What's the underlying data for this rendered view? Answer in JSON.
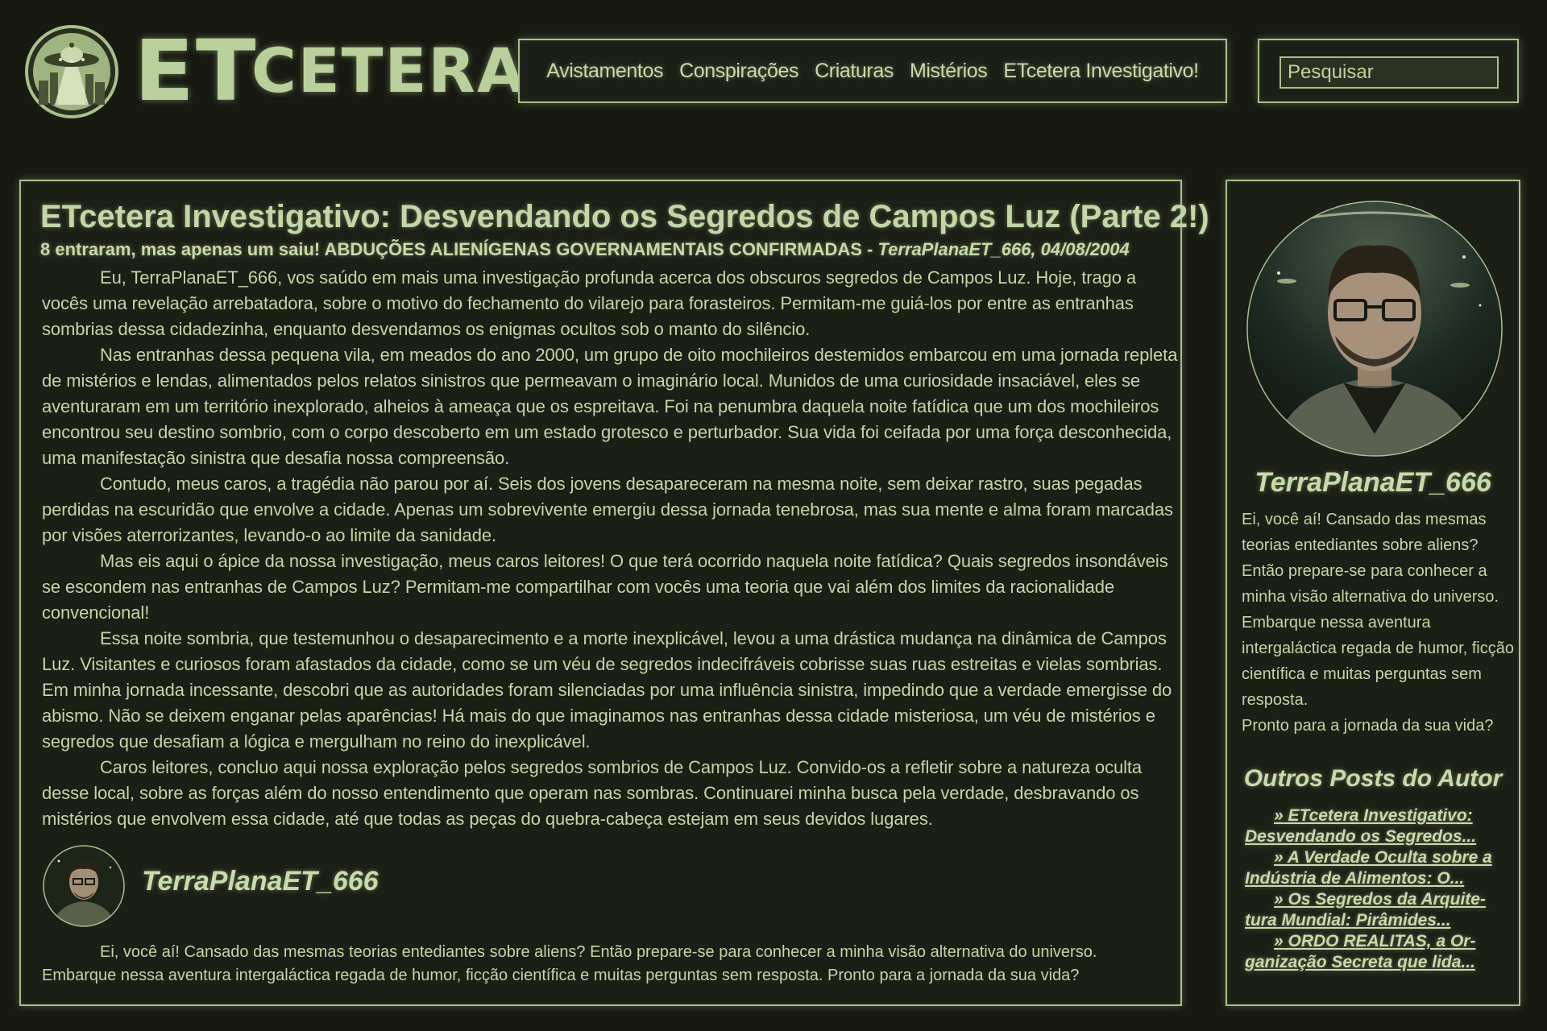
{
  "header": {
    "logo_big": "ET",
    "logo_small": "CETERA",
    "nav": [
      "Avistamentos",
      "Conspirações",
      "Criaturas",
      "Mistérios",
      "ETcetera Investigativo!"
    ],
    "search_placeholder": "Pesquisar"
  },
  "article": {
    "title": "ETcetera Investigativo: Desvendando os Segredos de Campos Luz (Parte 2!)",
    "meta_text": "8 entraram, mas apenas um saiu! ABDUÇÕES ALIENÍGENAS GOVERNAMENTAIS CONFIRMADAS - ",
    "meta_author_date": "TerraPlanaET_666, 04/08/2004",
    "paragraphs": [
      "Eu, TerraPlanaET_666, vos saúdo em mais uma investigação profunda acerca dos obscuros segredos de Campos Luz. Hoje, trago a vocês uma revelação arrebatadora, sobre o motivo do fechamento do vilarejo para forasteiros. Permitam-me guiá-los por entre as entranhas sombrias dessa cidadezinha, enquanto desvendamos os enigmas ocultos sob o manto do silêncio.",
      "Nas entranhas dessa pequena vila, em meados do ano 2000, um grupo de oito mochileiros destemidos embarcou em uma jornada repleta de mistérios e lendas, alimentados pelos relatos sinistros que permeavam o imaginário local. Munidos de uma curiosidade insaciável, eles se aventuraram em um território inexplorado, alheios à ameaça que os espreitava. Foi na penumbra daquela noite fatídica que um dos mochileiros encontrou seu destino sombrio, com o corpo descoberto em um estado grotesco e perturbador. Sua vida foi ceifada por uma força desconhecida, uma manifestação sinistra que desafia nossa compreensão.",
      "Contudo, meus caros, a tragédia não parou por aí. Seis dos jovens desapareceram na mesma noite, sem deixar rastro, suas pegadas perdidas na escuridão que envolve a cidade. Apenas um sobrevivente emergiu dessa jornada tenebrosa, mas sua mente e alma foram marcadas por visões aterrorizantes, levando-o ao limite da sanidade.",
      "Mas eis aqui o ápice da nossa investigação, meus caros leitores! O que terá ocorrido naquela noite fatídica? Quais segredos insondáveis se escondem nas entranhas de Campos Luz? Permitam-me compartilhar com vocês uma teoria que vai além dos limites da racionalidade convencional!",
      "Essa noite sombria, que testemunhou o desaparecimento e a morte inexplicável, levou a uma drástica mudança na dinâmica de Campos Luz. Visitantes e curiosos foram afastados da cidade, como se um véu de segredos indecifráveis cobrisse suas ruas estreitas e vielas sombrias. Em minha jornada incessante, descobri que as autoridades foram silenciadas por uma influência sinistra, impedindo que a verdade emergisse do abismo. Não se deixem enganar pelas aparências! Há mais do que imaginamos nas entranhas dessa cidade misteriosa, um véu de mistérios e segredos que desafiam a lógica e mergulham no reino do inexplicável.",
      "Caros leitores, concluo aqui nossa exploração pelos segredos sombrios de Campos Luz. Convido-os a refletir sobre a natureza oculta desse local, sobre as forças além do nosso entendimento que operam nas sombras. Continuarei minha busca pela verdade, desbravando os mistérios que envolvem essa cidade, até que todas as peças do quebra-cabeça estejam em seus devidos lugares."
    ],
    "author_name": "TerraPlanaET_666",
    "author_bio": "Ei, você aí! Cansado das mesmas teorias entediantes sobre aliens? Então prepare-se para conhecer a minha visão alternativa do universo. Embarque nessa aventura intergaláctica regada de humor, ficção científica e muitas perguntas sem resposta. Pronto para a jornada da sua vida?"
  },
  "sidebar": {
    "author_name": "TerraPlanaET_666",
    "bio_lines": [
      "Ei, você aí! Cansado das mesmas teorias entediantes sobre aliens?",
      "Então prepare-se para conhecer a minha visão alternativa do universo.",
      "Embarque nessa aventura intergaláctica regada de humor, ficção científica e muitas perguntas sem resposta.",
      "Pronto para a jornada da sua vida?"
    ],
    "other_posts_title": "Outros Posts do Autor",
    "other_posts": [
      "» ETcetera Investigativo: Desvendando os Segredos...",
      "» A Verdade Oculta sobre a Indústria de Alimentos: O...",
      "» Os Segredos da Arquite-tura Mundial: Pirâmides...",
      "» ORDO REALITAS, a Or-ganização Secreta que lida..."
    ]
  },
  "colors": {
    "background": "#181a12",
    "accent": "#a9bf8e",
    "text": "#c4d4a8"
  },
  "icons": {
    "logo": "ufo-emblem-icon",
    "avatar": "author-avatar"
  }
}
